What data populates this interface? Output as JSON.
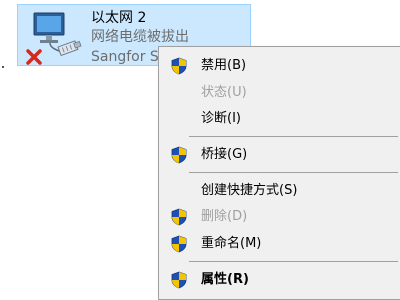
{
  "adapter": {
    "name": "以太网 2",
    "status": "网络电缆被拔出",
    "device": "Sangfor SSL VPN CS Support System VNIC",
    "icon": "network-adapter-disconnected-icon"
  },
  "menu": {
    "items": [
      {
        "label": "禁用(B)",
        "icon": "uac-shield-icon",
        "enabled": true
      },
      {
        "label": "状态(U)",
        "icon": null,
        "enabled": false
      },
      {
        "label": "诊断(I)",
        "icon": null,
        "enabled": true
      },
      {
        "label": "桥接(G)",
        "icon": "uac-shield-icon",
        "enabled": true
      },
      {
        "label": "创建快捷方式(S)",
        "icon": null,
        "enabled": true
      },
      {
        "label": "删除(D)",
        "icon": "uac-shield-icon",
        "enabled": false
      },
      {
        "label": "重命名(M)",
        "icon": "uac-shield-icon",
        "enabled": true
      },
      {
        "label": "属性(R)",
        "icon": "uac-shield-icon",
        "enabled": true,
        "bold": true
      }
    ]
  },
  "colors": {
    "selection_bg": "#cce8ff",
    "selection_border": "#99d1ff",
    "menu_bg": "#f0f0f0",
    "disabled_text": "#a0a0a0",
    "shield_blue": "#1e4fb4",
    "shield_yellow": "#f5c400",
    "error_red": "#d9261c"
  }
}
